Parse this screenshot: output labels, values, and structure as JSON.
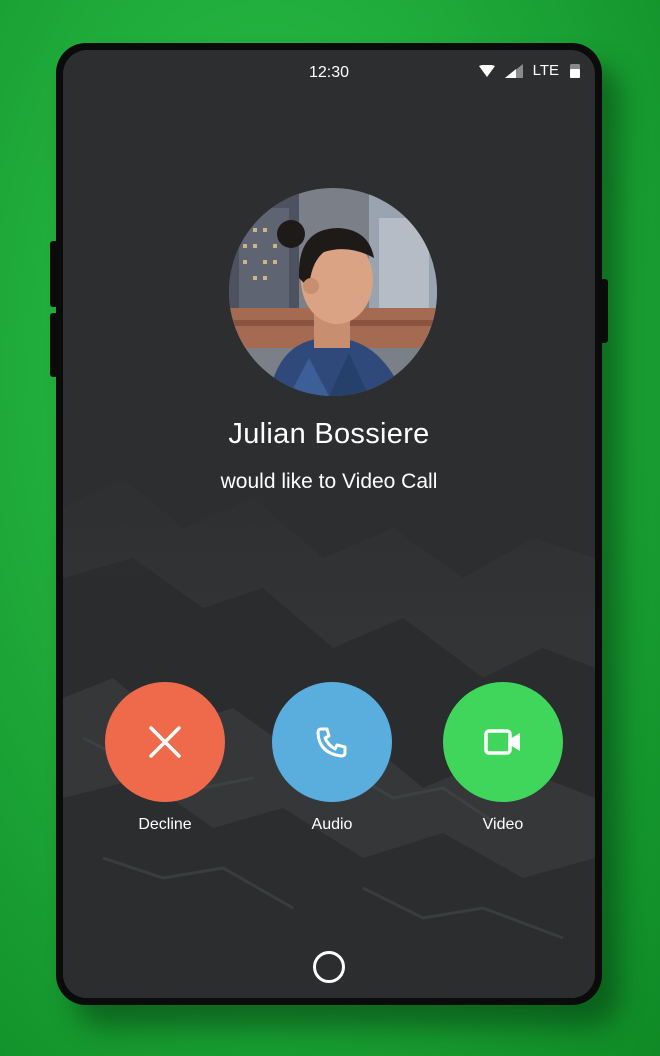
{
  "status_bar": {
    "time": "12:30",
    "network": "LTE"
  },
  "caller": {
    "name": "Julian Bossiere",
    "subtitle": "would like to Video Call"
  },
  "actions": [
    {
      "label": "Decline",
      "icon": "close-icon",
      "color": "#ee6a4b"
    },
    {
      "label": "Audio",
      "icon": "phone-icon",
      "color": "#5aaede"
    },
    {
      "label": "Video",
      "icon": "video-camera-icon",
      "color": "#3fd65b"
    }
  ],
  "navigation": {
    "home_icon": "home-circle-icon"
  }
}
